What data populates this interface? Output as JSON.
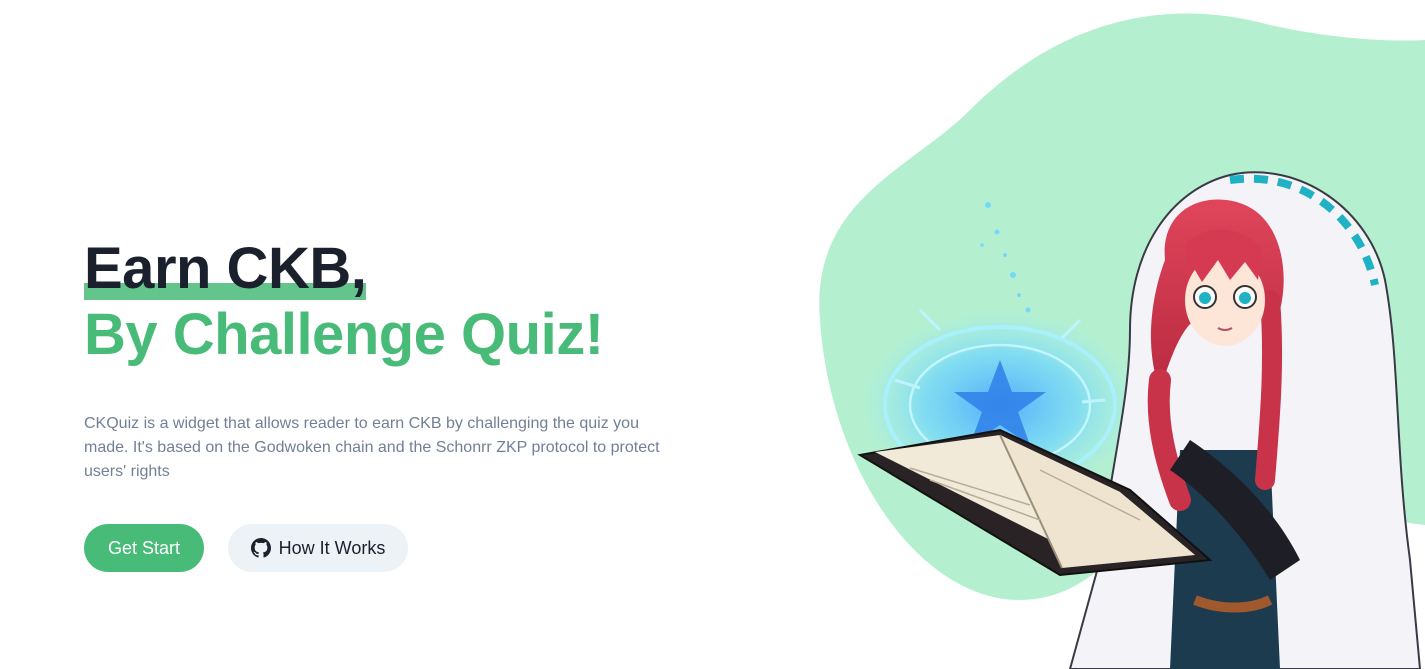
{
  "hero": {
    "headline_line1": "Earn CKB,",
    "headline_line2": "By Challenge Quiz!",
    "description": "CKQuiz is a widget that allows reader to earn CKB by challenging the quiz you made. It's based on the Godwoken chain and the Schonrr ZKP protocol to protect users' rights"
  },
  "actions": {
    "primary_label": "Get Start",
    "secondary_label": "How It Works",
    "secondary_icon": "github-icon"
  },
  "colors": {
    "accent": "#48bb78",
    "blob": "#b4f0d0",
    "heading": "#1a202c",
    "body_text": "#718096",
    "secondary_button_bg": "#edf2f7"
  },
  "illustration": {
    "subject": "anime mage girl in white hood holding glowing spell book",
    "icon": "mage-illustration"
  }
}
